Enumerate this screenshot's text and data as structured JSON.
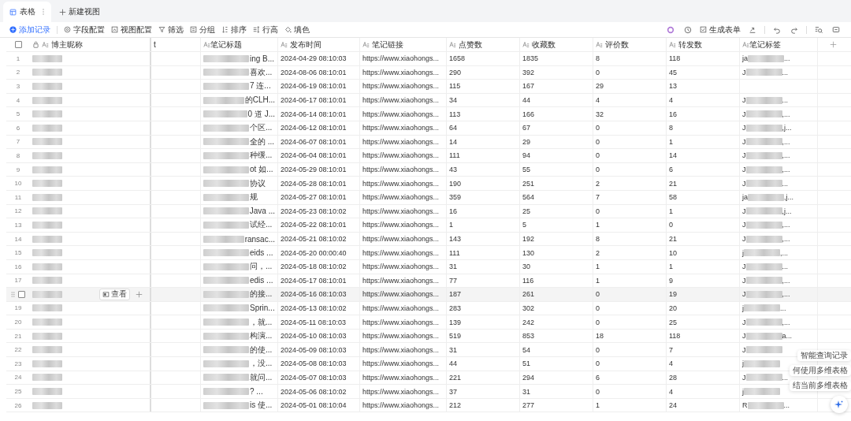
{
  "tabs": [
    {
      "label": "表格",
      "selected": true
    }
  ],
  "new_view": "新建视图",
  "toolbar": [
    {
      "kind": "add",
      "label": "添加记录"
    },
    {
      "kind": "gear",
      "label": "字段配置"
    },
    {
      "kind": "view",
      "label": "视图配置"
    },
    {
      "kind": "filter",
      "label": "筛选"
    },
    {
      "kind": "group",
      "label": "分组"
    },
    {
      "kind": "sort",
      "label": "排序"
    },
    {
      "kind": "height",
      "label": "行高"
    },
    {
      "kind": "fill",
      "label": "填色"
    }
  ],
  "generate_form": "生成表单",
  "all_selected": false,
  "columns": [
    {
      "label": "博主昵称",
      "locked": true
    },
    {
      "label": "t",
      "locked": false
    },
    {
      "label": "笔记标题",
      "locked": false
    },
    {
      "label": "发布时间",
      "locked": false
    },
    {
      "label": "笔记链接",
      "locked": false
    },
    {
      "label": "点赞数",
      "locked": false
    },
    {
      "label": "收藏数",
      "locked": false
    },
    {
      "label": "评价数",
      "locked": false
    },
    {
      "label": "转发数",
      "locked": false
    },
    {
      "label": "笔记标签",
      "locked": false
    }
  ],
  "rows": [
    {
      "index": "1",
      "hovered": false,
      "title": "ing B...",
      "time": "2024-04-29 08:10:03",
      "link": "https://www.xiaohongs...",
      "likes": "1658",
      "favorites": "1835",
      "comments": "8",
      "shares": "118",
      "tag_start": "ja",
      "tag_end": "..."
    },
    {
      "index": "2",
      "hovered": false,
      "title": "喜欢...",
      "time": "2024-08-06 08:10:01",
      "link": "https://www.xiaohongs...",
      "likes": "290",
      "favorites": "392",
      "comments": "0",
      "shares": "45",
      "tag_start": "J",
      "tag_end": "..."
    },
    {
      "index": "3",
      "hovered": false,
      "title": "7 连...",
      "time": "2024-06-19 08:10:01",
      "link": "https://www.xiaohongs...",
      "likes": "115",
      "favorites": "167",
      "comments": "29",
      "shares": "13"
    },
    {
      "index": "4",
      "hovered": false,
      "title": "的CLH...",
      "time": "2024-06-17 08:10:01",
      "link": "https://www.xiaohongs...",
      "likes": "34",
      "favorites": "44",
      "comments": "4",
      "shares": "4",
      "tag_start": "J",
      "tag_end": "..."
    },
    {
      "index": "5",
      "hovered": false,
      "title": "0 道 J...",
      "time": "2024-06-14 08:10:01",
      "link": "https://www.xiaohongs...",
      "likes": "113",
      "favorites": "166",
      "comments": "32",
      "shares": "16",
      "tag_start": "J",
      "tag_end": ",..."
    },
    {
      "index": "6",
      "hovered": false,
      "title": "个区...",
      "time": "2024-06-12 08:10:01",
      "link": "https://www.xiaohongs...",
      "likes": "64",
      "favorites": "67",
      "comments": "0",
      "shares": "8",
      "tag_start": "J",
      "tag_end": ",j..."
    },
    {
      "index": "7",
      "hovered": false,
      "title": "全的 ...",
      "time": "2024-06-07 08:10:01",
      "link": "https://www.xiaohongs...",
      "likes": "14",
      "favorites": "29",
      "comments": "0",
      "shares": "1",
      "tag_start": "J",
      "tag_end": ",..."
    },
    {
      "index": "8",
      "hovered": false,
      "title": "种缓...",
      "time": "2024-06-04 08:10:01",
      "link": "https://www.xiaohongs...",
      "likes": "111",
      "favorites": "94",
      "comments": "0",
      "shares": "14",
      "tag_start": "J",
      "tag_end": ",..."
    },
    {
      "index": "9",
      "hovered": false,
      "title": "ot 如...",
      "time": "2024-05-29 08:10:01",
      "link": "https://www.xiaohongs...",
      "likes": "43",
      "favorites": "55",
      "comments": "0",
      "shares": "6",
      "tag_start": "J",
      "tag_end": ",..."
    },
    {
      "index": "10",
      "hovered": false,
      "title": "协议",
      "time": "2024-05-28 08:10:01",
      "link": "https://www.xiaohongs...",
      "likes": "190",
      "favorites": "251",
      "comments": "2",
      "shares": "21",
      "tag_start": "J",
      "tag_end": "..."
    },
    {
      "index": "11",
      "hovered": false,
      "title": "规",
      "time": "2024-05-27 08:10:01",
      "link": "https://www.xiaohongs...",
      "likes": "359",
      "favorites": "564",
      "comments": "7",
      "shares": "58",
      "tag_start": "ja",
      "tag_end": ",j..."
    },
    {
      "index": "12",
      "hovered": false,
      "title": "Java ...",
      "time": "2024-05-23 08:10:02",
      "link": "https://www.xiaohongs...",
      "likes": "16",
      "favorites": "25",
      "comments": "0",
      "shares": "1",
      "tag_start": "J",
      "tag_end": ",j..."
    },
    {
      "index": "13",
      "hovered": false,
      "title": "试经...",
      "time": "2024-05-22 08:10:01",
      "link": "https://www.xiaohongs...",
      "likes": "1",
      "favorites": "5",
      "comments": "1",
      "shares": "0",
      "tag_start": "J",
      "tag_end": ",..."
    },
    {
      "index": "14",
      "hovered": false,
      "title": "ransac...",
      "time": "2024-05-21 08:10:02",
      "link": "https://www.xiaohongs...",
      "likes": "143",
      "favorites": "192",
      "comments": "8",
      "shares": "21",
      "tag_start": "J",
      "tag_end": ",..."
    },
    {
      "index": "15",
      "hovered": false,
      "title": "eids ...",
      "time": "2024-05-20 00:00:40",
      "link": "https://www.xiaohongs...",
      "likes": "111",
      "favorites": "130",
      "comments": "2",
      "shares": "10",
      "tag_start": "j",
      "tag_end": ",..."
    },
    {
      "index": "16",
      "hovered": false,
      "title": "问，...",
      "time": "2024-05-18 08:10:02",
      "link": "https://www.xiaohongs...",
      "likes": "31",
      "favorites": "30",
      "comments": "1",
      "shares": "1",
      "tag_start": "J",
      "tag_end": "..."
    },
    {
      "index": "17",
      "hovered": false,
      "title": "edis ...",
      "time": "2024-05-17 08:10:01",
      "link": "https://www.xiaohongs...",
      "likes": "77",
      "favorites": "116",
      "comments": "1",
      "shares": "9",
      "tag_start": "J",
      "tag_end": ",..."
    },
    {
      "hovered": true,
      "checked": false,
      "view_label": "查看",
      "title": "的接...",
      "time": "2024-05-16 08:10:03",
      "link": "https://www.xiaohongs...",
      "likes": "187",
      "favorites": "261",
      "comments": "0",
      "shares": "19",
      "tag_start": "J",
      "tag_end": ",..."
    },
    {
      "index": "19",
      "hovered": false,
      "title": "Sprin...",
      "time": "2024-05-13 08:10:02",
      "link": "https://www.xiaohongs...",
      "likes": "283",
      "favorites": "302",
      "comments": "0",
      "shares": "20",
      "tag_start": "j",
      "tag_end": "..."
    },
    {
      "index": "20",
      "hovered": false,
      "title": "，就...",
      "time": "2024-05-11 08:10:03",
      "link": "https://www.xiaohongs...",
      "likes": "139",
      "favorites": "242",
      "comments": "0",
      "shares": "25",
      "tag_start": "J",
      "tag_end": ",..."
    },
    {
      "index": "21",
      "hovered": false,
      "title": "构演...",
      "time": "2024-05-10 08:10:03",
      "link": "https://www.xiaohongs...",
      "likes": "519",
      "favorites": "853",
      "comments": "18",
      "shares": "118",
      "tag_start": "J",
      "tag_end": "a..."
    },
    {
      "index": "22",
      "hovered": false,
      "title": "的使...",
      "time": "2024-05-09 08:10:03",
      "link": "https://www.xiaohongs...",
      "likes": "31",
      "favorites": "54",
      "comments": "0",
      "shares": "7",
      "tag_start": "J"
    },
    {
      "index": "23",
      "hovered": false,
      "title": "，没...",
      "time": "2024-05-08 08:10:03",
      "link": "https://www.xiaohongs...",
      "likes": "44",
      "favorites": "51",
      "comments": "0",
      "shares": "4",
      "tag_start": "j"
    },
    {
      "index": "24",
      "hovered": false,
      "title": "就问...",
      "time": "2024-05-07 08:10:03",
      "link": "https://www.xiaohongs...",
      "likes": "221",
      "favorites": "294",
      "comments": "6",
      "shares": "28",
      "tag_start": "J",
      "tag_end": "..."
    },
    {
      "index": "25",
      "hovered": false,
      "title": "? ...",
      "time": "2024-05-06 08:10:02",
      "link": "https://www.xiaohongs...",
      "likes": "37",
      "favorites": "31",
      "comments": "0",
      "shares": "4",
      "tag_start": "j"
    },
    {
      "index": "26",
      "hovered": false,
      "title": "is 使...",
      "time": "2024-05-01 08:10:04",
      "link": "https://www.xiaohongs...",
      "likes": "212",
      "favorites": "277",
      "comments": "1",
      "shares": "24",
      "tag_start": "R",
      "tag_end": "..."
    }
  ],
  "assistant_suggestions": [
    "智能查询记录",
    "何使用多维表格",
    "结当前多维表格"
  ]
}
